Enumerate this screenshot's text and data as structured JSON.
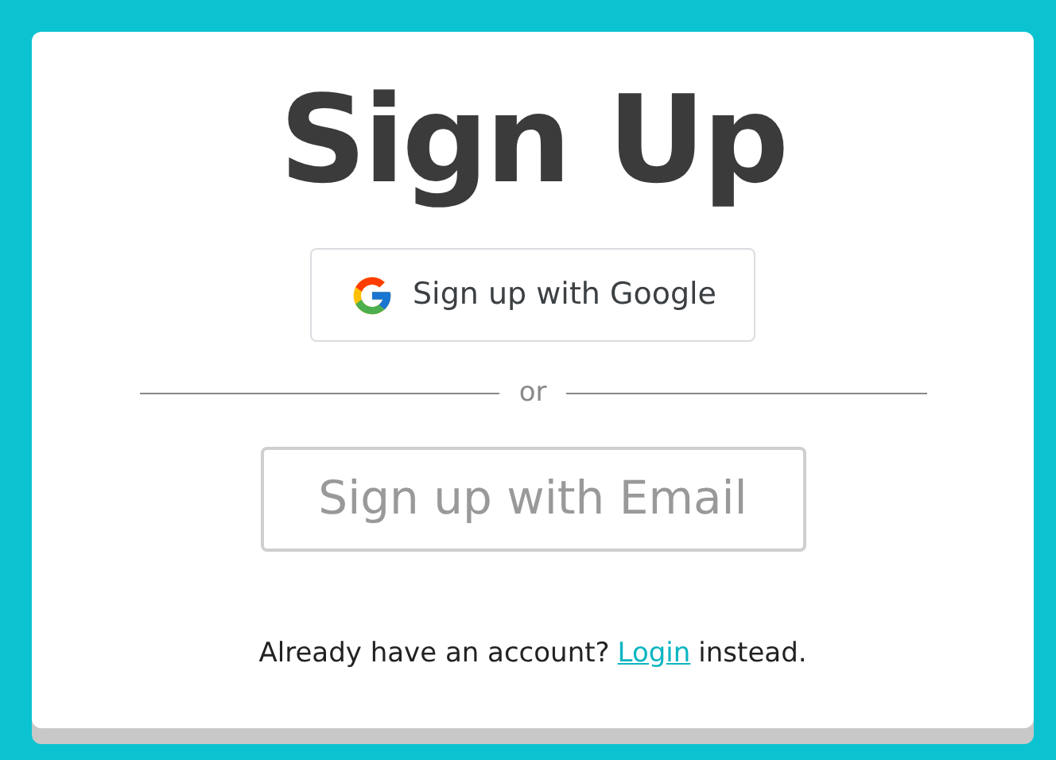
{
  "title": "Sign Up",
  "google_button": {
    "label": "Sign up with Google"
  },
  "divider": {
    "label": "or"
  },
  "email_button": {
    "label": "Sign up with Email"
  },
  "footer": {
    "prefix": "Already have an account?",
    "link": "Login",
    "suffix": "instead."
  }
}
